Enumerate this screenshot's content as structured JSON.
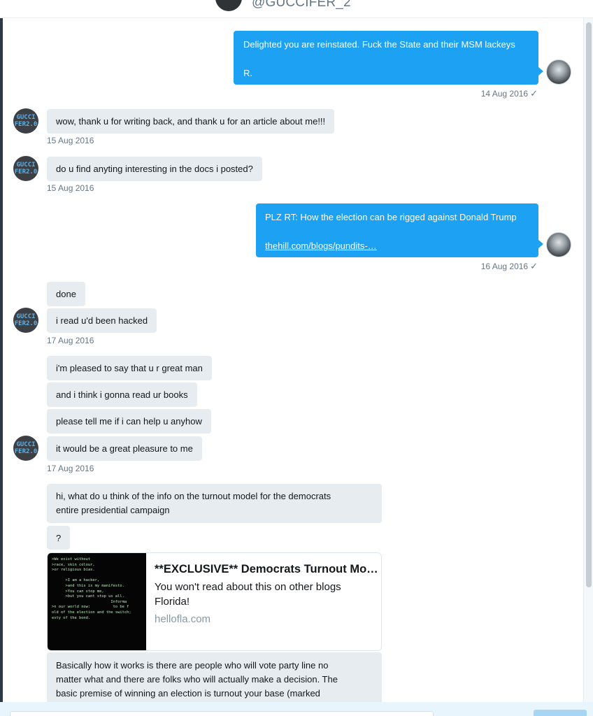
{
  "header": {
    "handle": "@GUCCIFER_2"
  },
  "guccifer_avatar": {
    "line1": "GUCCI",
    "line2": "FER2.0"
  },
  "messages": {
    "m1": {
      "line1": "Delighted you are reinstated. Fuck the State and their MSM lackeys",
      "line2": "R.",
      "time": "14 Aug 2016"
    },
    "m2": {
      "text": "wow, thank u for writing back, and thank u for an article about me!!!",
      "time": "15 Aug 2016"
    },
    "m3": {
      "text": "do u find anyting interesting in the docs i posted?",
      "time": "15 Aug 2016"
    },
    "m4": {
      "text": "PLZ RT: How the election can be rigged against Donald Trump",
      "link": "thehill.com/blogs/pundits-…",
      "time": "16 Aug 2016"
    },
    "m5": {
      "text": "done"
    },
    "m6": {
      "text": "i read u'd been hacked",
      "time": "17 Aug 2016"
    },
    "m7": {
      "text": "i'm pleased to say that u r great man"
    },
    "m8": {
      "text": "and i think i gonna read ur books"
    },
    "m9": {
      "text": "please tell me if i can help u anyhow"
    },
    "m10": {
      "text": "it would be a great pleasure to me",
      "time": "17 Aug 2016"
    },
    "m11": {
      "line1": "hi, what do u think of the info on the turnout model for the democrats",
      "line2": "entire presidential campaign"
    },
    "m12": {
      "text": "?"
    },
    "m13": {
      "line1": "Basically how it works is there are people who will vote party line no",
      "line2": "matter what and there are folks who will actually make a decision.  The",
      "line3": "basic premise of winning an election is turnout your base (marked"
    }
  },
  "card": {
    "title": "**EXCLUSIVE** Democrats Turnout Mo…",
    "desc_line1": "You won't read about this on other blogs",
    "desc_line2": "Florida!",
    "domain": "hellofla.com",
    "image_text": ">We exist without\n>race, skin colour,\n>or religious bias.\n\n      >I am a hacker,\n      >and this is my manifesto.\n      >You can stop me,\n      >but you cant stop us all.\n                          Informa\n>n our world now:          to be f\nold of the election and the switch;\nesty of the bond."
  },
  "check_glyph": "✓",
  "colors": {
    "outgoing": "#1da1f2",
    "incoming": "#e6ecf0",
    "timestamp": "#657786"
  },
  "icons": [
    "checkmark-icon",
    "avatar-photo",
    "avatar-guccifer"
  ]
}
